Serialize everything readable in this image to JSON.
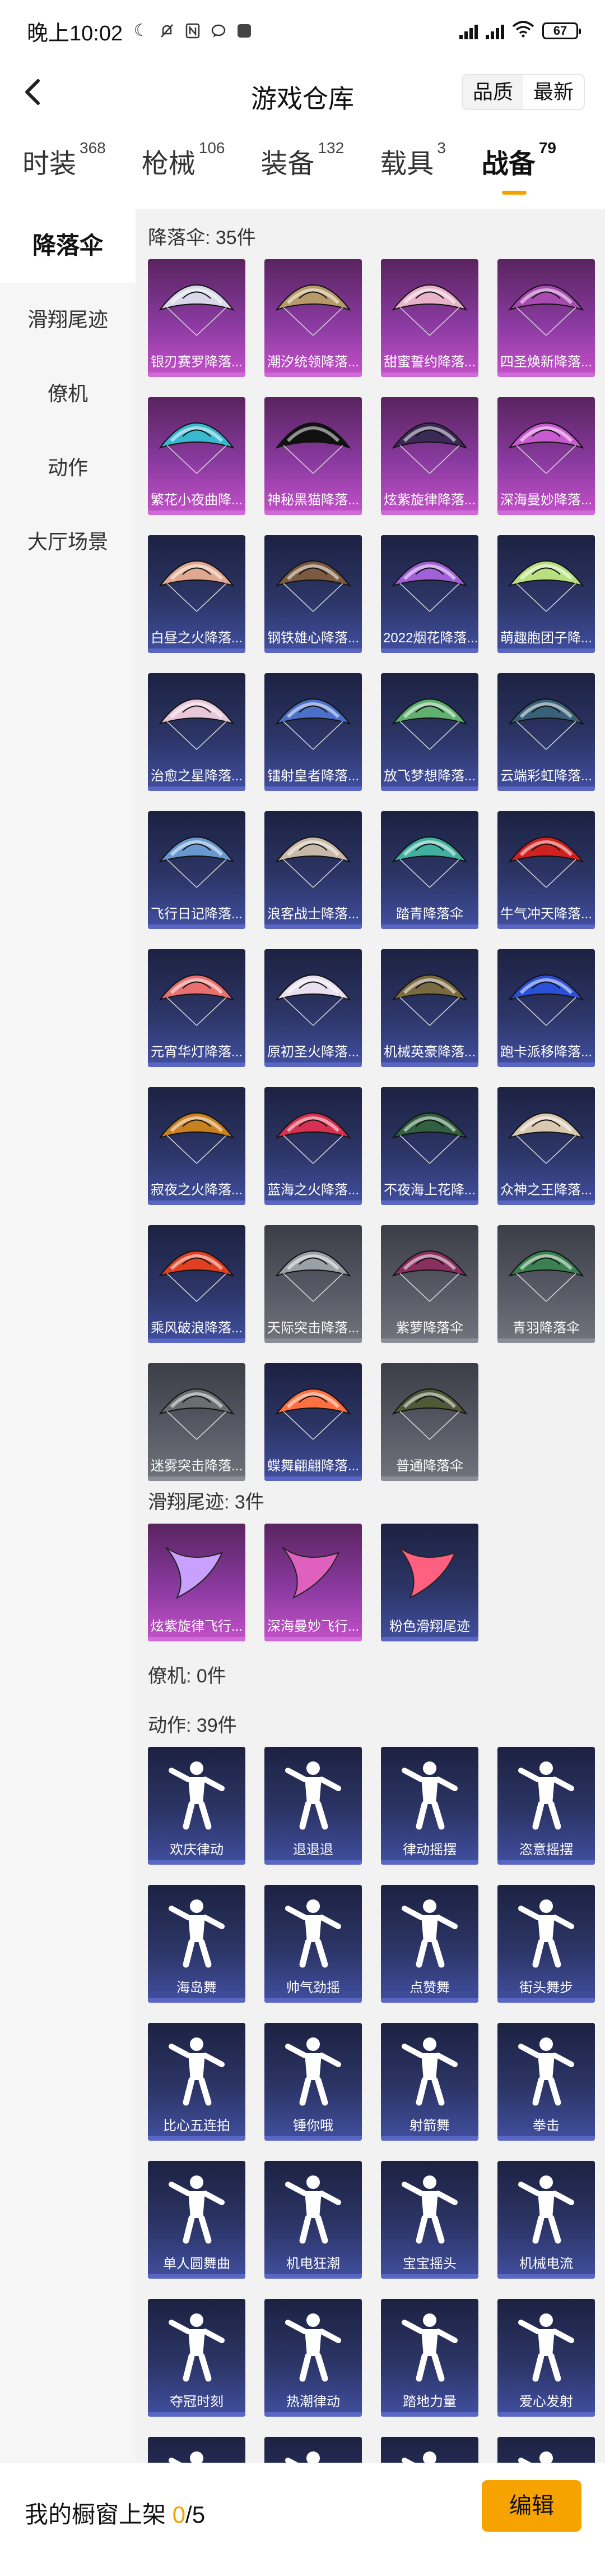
{
  "status_bar": {
    "time": "晚上10:02",
    "battery": "67"
  },
  "header": {
    "title": "游戏仓库",
    "sort_quality": "品质",
    "sort_latest": "最新"
  },
  "tabs": [
    {
      "label": "时装",
      "count": "368"
    },
    {
      "label": "枪械",
      "count": "106"
    },
    {
      "label": "装备",
      "count": "132"
    },
    {
      "label": "载具",
      "count": "3"
    },
    {
      "label": "战备",
      "count": "79"
    }
  ],
  "active_tab": 4,
  "sidebar": [
    "降落伞",
    "滑翔尾迹",
    "僚机",
    "动作",
    "大厅场景"
  ],
  "sections": {
    "parachute": {
      "title": "降落伞: 35件",
      "items": [
        {
          "label": "银刃赛罗降落..."
        },
        {
          "label": "潮汐统领降落..."
        },
        {
          "label": "甜蜜誓约降落..."
        },
        {
          "label": "四圣焕新降落..."
        },
        {
          "label": "繁花小夜曲降..."
        },
        {
          "label": "神秘黑猫降落..."
        },
        {
          "label": "炫紫旋律降落..."
        },
        {
          "label": "深海曼妙降落..."
        },
        {
          "label": "白昼之火降落..."
        },
        {
          "label": "钢铁雄心降落..."
        },
        {
          "label": "2022烟花降落..."
        },
        {
          "label": "萌趣胞团子降..."
        },
        {
          "label": "治愈之星降落..."
        },
        {
          "label": "镭射皇者降落..."
        },
        {
          "label": "放飞梦想降落..."
        },
        {
          "label": "云端彩虹降落..."
        },
        {
          "label": "飞行日记降落..."
        },
        {
          "label": "浪客战士降落..."
        },
        {
          "label": "踏青降落伞"
        },
        {
          "label": "牛气冲天降落..."
        },
        {
          "label": "元宵华灯降落..."
        },
        {
          "label": "原初圣火降落..."
        },
        {
          "label": "机械英豪降落..."
        },
        {
          "label": "跑卡派移降落..."
        },
        {
          "label": "寂夜之火降落..."
        },
        {
          "label": "蓝海之火降落..."
        },
        {
          "label": "不夜海上花降..."
        },
        {
          "label": "众神之王降落..."
        },
        {
          "label": "乘风破浪降落..."
        },
        {
          "label": "天际突击降落..."
        },
        {
          "label": "紫萝降落伞"
        },
        {
          "label": "青羽降落伞"
        },
        {
          "label": "迷雾突击降落..."
        },
        {
          "label": "蝶舞翩翩降落..."
        },
        {
          "label": "普通降落伞"
        }
      ]
    },
    "trail": {
      "title": "滑翔尾迹: 3件",
      "items": [
        {
          "label": "炫紫旋律飞行..."
        },
        {
          "label": "深海曼妙飞行..."
        },
        {
          "label": "粉色滑翔尾迹"
        }
      ]
    },
    "wingman": {
      "title": "僚机: 0件"
    },
    "emote": {
      "title": "动作: 39件",
      "items": [
        {
          "label": "欢庆律动"
        },
        {
          "label": "退退退"
        },
        {
          "label": "律动摇摆"
        },
        {
          "label": "恣意摇摆"
        },
        {
          "label": "海岛舞"
        },
        {
          "label": "帅气劲摇"
        },
        {
          "label": "点赞舞"
        },
        {
          "label": "街头舞步"
        },
        {
          "label": "比心五连拍"
        },
        {
          "label": "锤你哦"
        },
        {
          "label": "射箭舞"
        },
        {
          "label": "拳击"
        },
        {
          "label": "单人圆舞曲"
        },
        {
          "label": "机电狂潮"
        },
        {
          "label": "宝宝摇头"
        },
        {
          "label": "机械电流"
        },
        {
          "label": "夺冠时刻"
        },
        {
          "label": "热潮律动"
        },
        {
          "label": "踏地力量"
        },
        {
          "label": "爱心发射"
        },
        {
          "label": ""
        },
        {
          "label": ""
        },
        {
          "label": ""
        },
        {
          "label": ""
        }
      ]
    }
  },
  "colors": {
    "accent": "#f6a300",
    "rare_purple": "#c451c9",
    "rare_blue": "#414fa0",
    "common_gray": "#71747c"
  },
  "bottom_bar": {
    "label": "我的橱窗上架",
    "count": "0",
    "total": "/5",
    "edit_label": "编辑"
  }
}
